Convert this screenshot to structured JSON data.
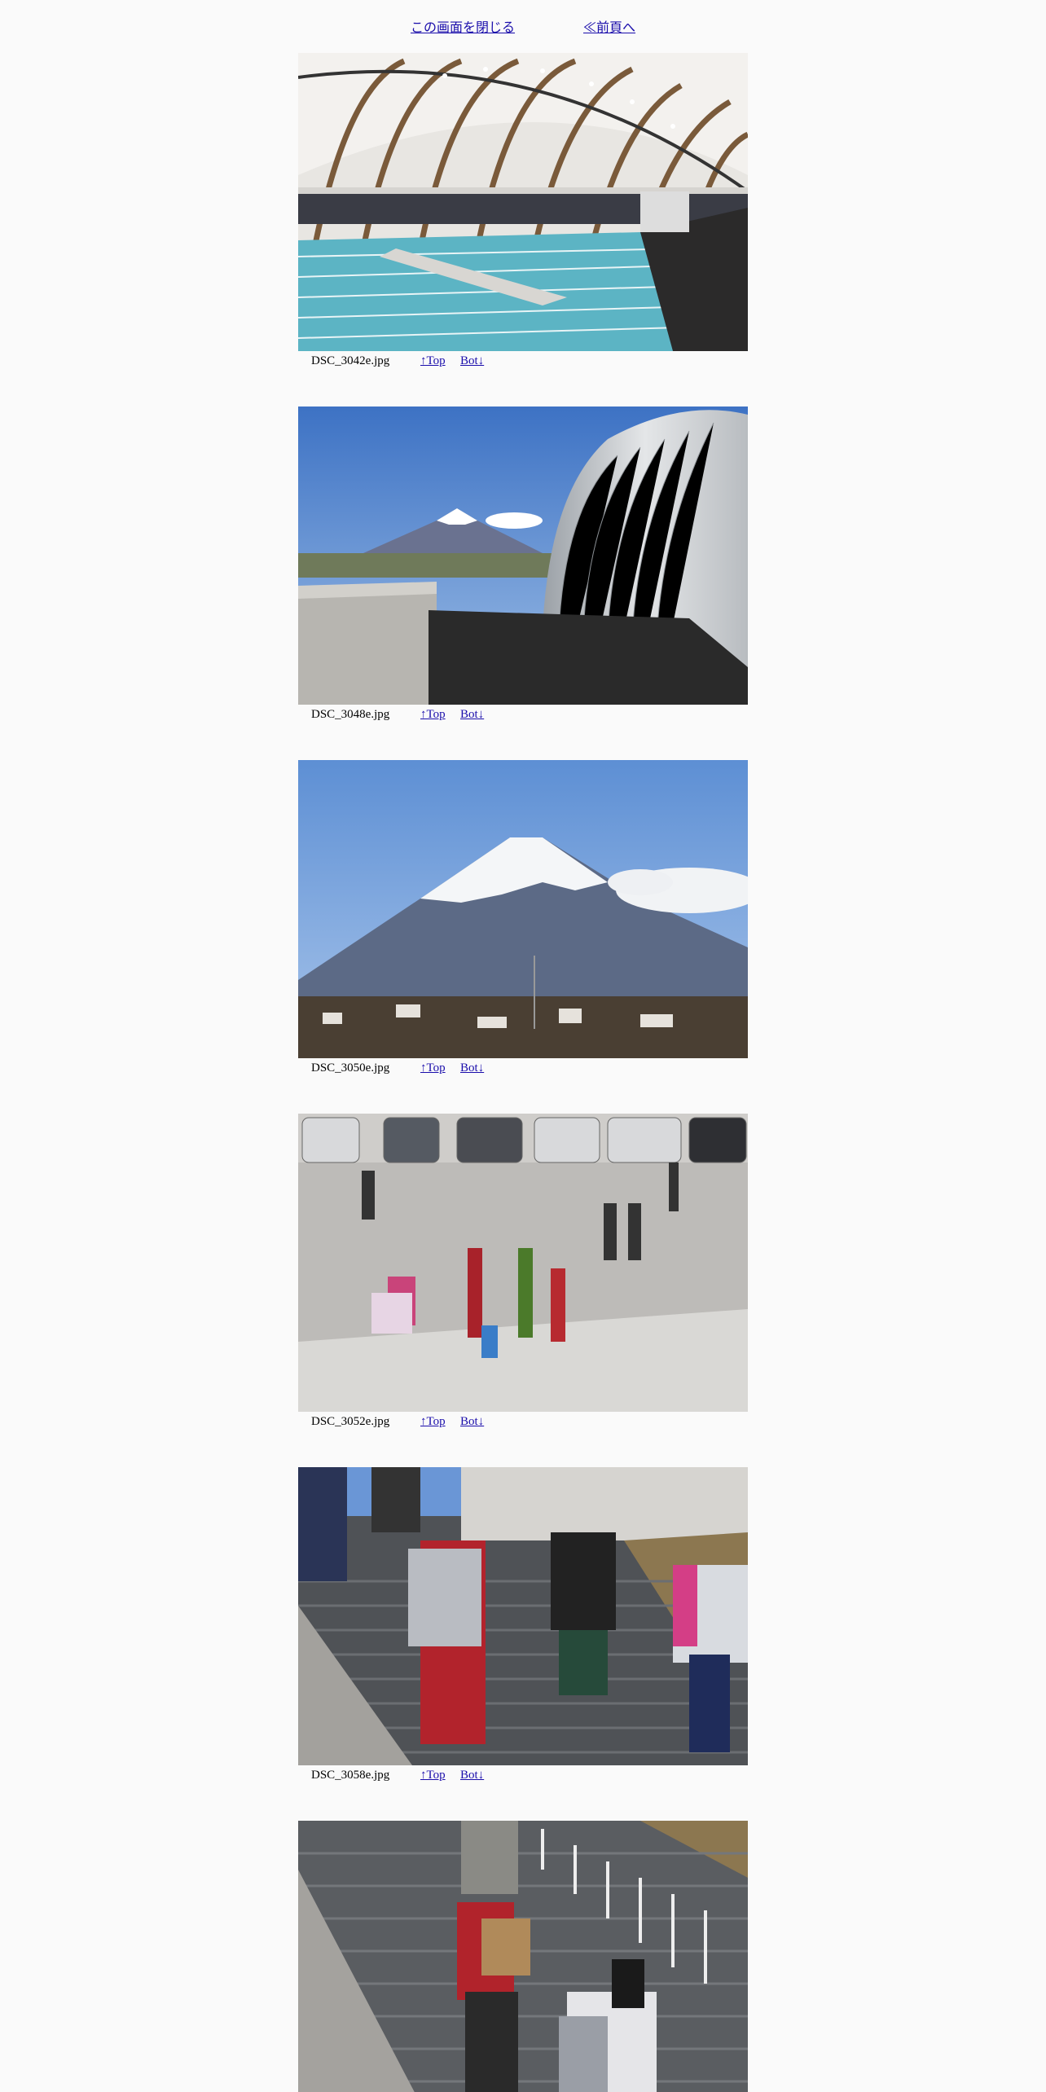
{
  "nav": {
    "close_label": "この画面を閉じる",
    "prev_label": "≪前頁へ"
  },
  "photos": [
    {
      "filename": "DSC_3042e.jpg",
      "top_label": "↑Top",
      "bottom_label": "Bot↓",
      "subject": "indoor swimming pool under arched roof"
    },
    {
      "filename": "DSC_3048e.jpg",
      "top_label": "↑Top",
      "bottom_label": "Bot↓",
      "subject": "Mount Fuji beside curved metallic building"
    },
    {
      "filename": "DSC_3050e.jpg",
      "top_label": "↑Top",
      "bottom_label": "Bot↓",
      "subject": "snow-capped Mount Fuji over town"
    },
    {
      "filename": "DSC_3052e.jpg",
      "top_label": "↑Top",
      "bottom_label": "Bot↓",
      "subject": "people in parking lot carrying bags"
    },
    {
      "filename": "DSC_3058e.jpg",
      "top_label": "↑Top",
      "bottom_label": "Bot↓",
      "subject": "students walking down concrete stairs"
    },
    {
      "filename": "",
      "top_label": "",
      "bottom_label": "",
      "subject": "students carrying boxes down stairs"
    }
  ]
}
